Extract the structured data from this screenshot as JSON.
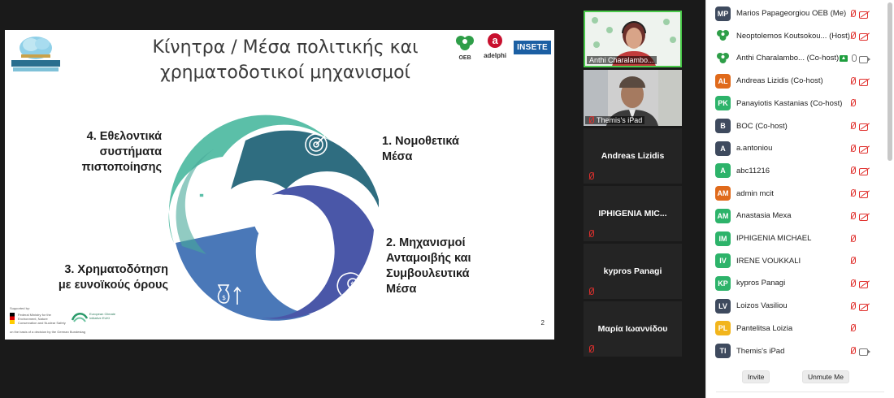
{
  "slide": {
    "title_line1": "Κίνητρα / Μέσα πολιτικής και",
    "title_line2": "χρηματοδοτικοί μηχανισμοί",
    "label1_line1": "1. Νομοθετικά",
    "label1_line2": "Μέσα",
    "label2_line1": "2. Μηχανισμοί",
    "label2_line2": "Ανταμοιβής και",
    "label2_line3": "Συμβουλευτικά",
    "label2_line4": "Μέσα",
    "label3_line1": "3. Χρηματοδότηση",
    "label3_line2": "με ευνοϊκούς όρους",
    "label4_line1": "4. Εθελοντικά",
    "label4_line2": "συστήματα",
    "label4_line3": "πιστοποίησης",
    "page_number": "2",
    "logo_oeb": "OEB",
    "logo_adelphi": "adelphi",
    "logo_insete": "INSETE",
    "sponsor_top": "Supported by:",
    "sponsor_bmu": "Federal Ministry for the Environment, Nature Conservation and Nuclear Safety",
    "sponsor_euki": "European Climate Initiative EUKI",
    "sponsor_bottom": "on the basis of a decision by the German Bundestag",
    "colors": {
      "teal": "#5bbfa8",
      "teal_dark": "#2c8a80",
      "slate": "#2f6d80",
      "indigo": "#4a57a8",
      "blue": "#4a78b8"
    }
  },
  "video_tiles": [
    {
      "name": "Anthi Charalambo...",
      "muted": false
    },
    {
      "name": "Themis's iPad",
      "muted": true
    },
    {
      "name": "Andreas Lizidis",
      "muted": true
    },
    {
      "name": "IPHIGENIA MIC...",
      "muted": true
    },
    {
      "name": "kypros Panagi",
      "muted": true
    },
    {
      "name": "Μαρία Ιωαννίδου",
      "muted": true
    }
  ],
  "participants": [
    {
      "initials": "MP",
      "name": "Marios Papageorgiou OEB (Me)",
      "color": "#3e4a5e",
      "mic": "off",
      "cam": "off"
    },
    {
      "initials": "",
      "name": "Neoptolemos Koutsokou... (Host)",
      "color": "#ffffff",
      "mic": "off",
      "cam": "off"
    },
    {
      "initials": "",
      "name": "Anthi Charalambo... (Co-host)",
      "color": "#ffffff",
      "mic": "on",
      "cam": "on",
      "share": true
    },
    {
      "initials": "AL",
      "name": "Andreas Lizidis (Co-host)",
      "color": "#e06a1b",
      "mic": "off",
      "cam": "off"
    },
    {
      "initials": "PK",
      "name": "Panayiotis Kastanias (Co-host)",
      "color": "#2db36a",
      "mic": "off",
      "cam": "none"
    },
    {
      "initials": "B",
      "name": "BOC (Co-host)",
      "color": "#3e4a5e",
      "mic": "off",
      "cam": "off"
    },
    {
      "initials": "A",
      "name": "a.antoniou",
      "color": "#3e4a5e",
      "mic": "off",
      "cam": "off"
    },
    {
      "initials": "A",
      "name": "abc11216",
      "color": "#2db36a",
      "mic": "off",
      "cam": "off"
    },
    {
      "initials": "AM",
      "name": "admin mcit",
      "color": "#e06a1b",
      "mic": "off",
      "cam": "off"
    },
    {
      "initials": "AM",
      "name": "Anastasia Mexa",
      "color": "#2db36a",
      "mic": "off",
      "cam": "off"
    },
    {
      "initials": "IM",
      "name": "IPHIGENIA MICHAEL",
      "color": "#2db36a",
      "mic": "off",
      "cam": "none"
    },
    {
      "initials": "IV",
      "name": "IRENE VOUKKALI",
      "color": "#2db36a",
      "mic": "off",
      "cam": "none"
    },
    {
      "initials": "KP",
      "name": "kypros Panagi",
      "color": "#2db36a",
      "mic": "off",
      "cam": "off"
    },
    {
      "initials": "LV",
      "name": "Loizos Vasiliou",
      "color": "#3e4a5e",
      "mic": "off",
      "cam": "off"
    },
    {
      "initials": "PL",
      "name": "Pantelitsa Loizia",
      "color": "#f2b51c",
      "mic": "off",
      "cam": "none"
    },
    {
      "initials": "TI",
      "name": "Themis's iPad",
      "color": "#3e4a5e",
      "mic": "off",
      "cam": "on"
    }
  ],
  "buttons": {
    "invite": "Invite",
    "unmute_me": "Unmute Me"
  }
}
